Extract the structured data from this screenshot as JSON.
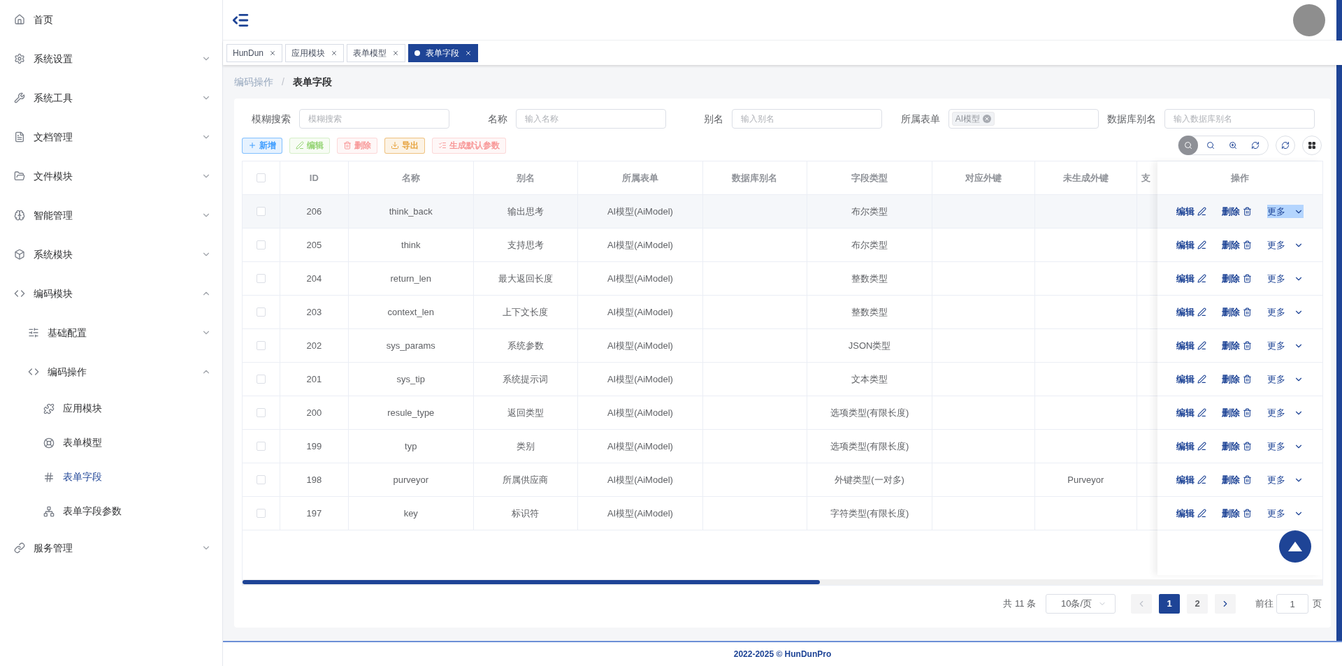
{
  "sidebar": {
    "items": [
      {
        "label": "首页",
        "selected": false
      },
      {
        "label": "系统设置",
        "expanded": false,
        "selected": false
      },
      {
        "label": "系统工具",
        "expanded": false,
        "selected": false
      },
      {
        "label": "文档管理",
        "expanded": false,
        "selected": false
      },
      {
        "label": "文件模块",
        "expanded": false,
        "selected": false
      },
      {
        "label": "智能管理",
        "expanded": false,
        "selected": false
      },
      {
        "label": "系统模块",
        "expanded": false,
        "selected": false
      },
      {
        "label": "编码模块",
        "expanded": true,
        "selected": false,
        "children": [
          {
            "label": "基础配置",
            "expanded": false,
            "selected": false
          },
          {
            "label": "编码操作",
            "expanded": true,
            "selected": false,
            "children": [
              {
                "label": "应用模块",
                "selected": false
              },
              {
                "label": "表单模型",
                "selected": false
              },
              {
                "label": "表单字段",
                "selected": true
              },
              {
                "label": "表单字段参数",
                "selected": false
              }
            ]
          }
        ]
      },
      {
        "label": "服务管理",
        "expanded": false,
        "selected": false
      }
    ]
  },
  "tabs": [
    {
      "label": "HunDun",
      "selected": false
    },
    {
      "label": "应用模块",
      "selected": false
    },
    {
      "label": "表单模型",
      "selected": false
    },
    {
      "label": "表单字段",
      "selected": true
    }
  ],
  "breadcrumb": {
    "items": [
      "编码操作",
      "表单字段"
    ],
    "separator": "/"
  },
  "filters": [
    {
      "label": "模糊搜索",
      "kind": "input",
      "placeholder": "模糊搜索"
    },
    {
      "label": "名称",
      "kind": "input",
      "placeholder": "输入名称"
    },
    {
      "label": "别名",
      "kind": "input",
      "placeholder": "输入别名"
    },
    {
      "label": "所属表单",
      "kind": "tags",
      "tags": [
        "AI模型"
      ]
    },
    {
      "label": "数据库别名",
      "kind": "input",
      "placeholder": "输入数据库别名"
    }
  ],
  "actions": [
    {
      "label": "新增",
      "color": "#409eff",
      "disabled": false
    },
    {
      "label": "编辑",
      "color": "#95d475",
      "disabled": true
    },
    {
      "label": "删除",
      "color": "#f89898",
      "disabled": true
    },
    {
      "label": "导出",
      "color": "#e6a23c",
      "disabled": false
    },
    {
      "label": "生成默认参数",
      "color": "#f89898",
      "disabled": true
    }
  ],
  "view_toggles": [
    {
      "selected": true
    },
    {
      "selected": false
    },
    {
      "selected": false
    },
    {
      "selected": false
    }
  ],
  "table": {
    "select_all_checked": false,
    "columns": [
      "ID",
      "名称",
      "别名",
      "所属表单",
      "数据库别名",
      "字段类型",
      "对应外键",
      "未生成外键",
      "支"
    ],
    "action_column": "操作",
    "rows": [
      {
        "checked": false,
        "cells": [
          "206",
          "think_back",
          "输出思考",
          "AI模型(AiModel)",
          "",
          "布尔类型",
          "",
          "",
          ""
        ],
        "highlighted": true,
        "actions": [
          "编辑",
          "删除",
          "更多"
        ]
      },
      {
        "checked": false,
        "cells": [
          "205",
          "think",
          "支持思考",
          "AI模型(AiModel)",
          "",
          "布尔类型",
          "",
          "",
          ""
        ],
        "highlighted": false,
        "actions": [
          "编辑",
          "删除",
          "更多"
        ]
      },
      {
        "checked": false,
        "cells": [
          "204",
          "return_len",
          "最大返回长度",
          "AI模型(AiModel)",
          "",
          "整数类型",
          "",
          "",
          ""
        ],
        "highlighted": false,
        "actions": [
          "编辑",
          "删除",
          "更多"
        ]
      },
      {
        "checked": false,
        "cells": [
          "203",
          "context_len",
          "上下文长度",
          "AI模型(AiModel)",
          "",
          "整数类型",
          "",
          "",
          ""
        ],
        "highlighted": false,
        "actions": [
          "编辑",
          "删除",
          "更多"
        ]
      },
      {
        "checked": false,
        "cells": [
          "202",
          "sys_params",
          "系统参数",
          "AI模型(AiModel)",
          "",
          "JSON类型",
          "",
          "",
          ""
        ],
        "highlighted": false,
        "actions": [
          "编辑",
          "删除",
          "更多"
        ]
      },
      {
        "checked": false,
        "cells": [
          "201",
          "sys_tip",
          "系统提示词",
          "AI模型(AiModel)",
          "",
          "文本类型",
          "",
          "",
          ""
        ],
        "highlighted": false,
        "actions": [
          "编辑",
          "删除",
          "更多"
        ]
      },
      {
        "checked": false,
        "cells": [
          "200",
          "resule_type",
          "返回类型",
          "AI模型(AiModel)",
          "",
          "选项类型(有限长度)",
          "",
          "",
          ""
        ],
        "highlighted": false,
        "actions": [
          "编辑",
          "删除",
          "更多"
        ]
      },
      {
        "checked": false,
        "cells": [
          "199",
          "typ",
          "类别",
          "AI模型(AiModel)",
          "",
          "选项类型(有限长度)",
          "",
          "",
          ""
        ],
        "highlighted": false,
        "actions": [
          "编辑",
          "删除",
          "更多"
        ]
      },
      {
        "checked": false,
        "cells": [
          "198",
          "purveyor",
          "所属供应商",
          "AI模型(AiModel)",
          "",
          "外键类型(一对多)",
          "",
          "Purveyor",
          ""
        ],
        "highlighted": false,
        "actions": [
          "编辑",
          "删除",
          "更多"
        ]
      },
      {
        "checked": false,
        "cells": [
          "197",
          "key",
          "标识符",
          "AI模型(AiModel)",
          "",
          "字符类型(有限长度)",
          "",
          "",
          ""
        ],
        "highlighted": false,
        "actions": [
          "编辑",
          "删除",
          "更多"
        ]
      }
    ]
  },
  "pagination": {
    "total": "共 11 条",
    "page_size": "10条/页",
    "prev_disabled": true,
    "pages": [
      {
        "label": "1",
        "selected": true
      },
      {
        "label": "2",
        "selected": false
      }
    ],
    "goto_label": "前往",
    "goto_value": "1",
    "goto_suffix": "页"
  },
  "footer": "2022-2025 © HunDunPro"
}
